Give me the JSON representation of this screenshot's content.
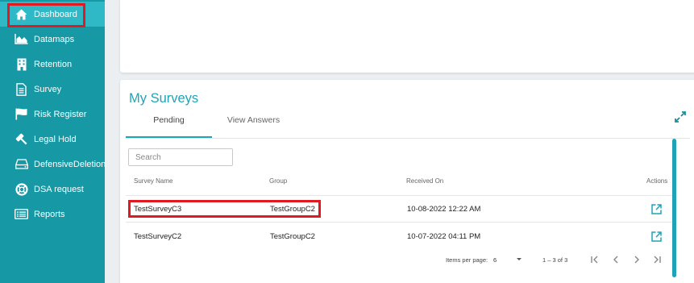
{
  "sidebar": {
    "items": [
      {
        "label": "Dashboard",
        "icon": "home-icon"
      },
      {
        "label": "Datamaps",
        "icon": "area-chart-icon"
      },
      {
        "label": "Retention",
        "icon": "building-icon"
      },
      {
        "label": "Survey",
        "icon": "document-icon"
      },
      {
        "label": "Risk Register",
        "icon": "flag-icon"
      },
      {
        "label": "Legal Hold",
        "icon": "gavel-icon"
      },
      {
        "label": "DefensiveDeletion",
        "icon": "drive-icon"
      },
      {
        "label": "DSA request",
        "icon": "lifebuoy-icon"
      },
      {
        "label": "Reports",
        "icon": "list-icon"
      }
    ],
    "active": "Dashboard"
  },
  "surveys": {
    "title": "My Surveys",
    "tabs": [
      "Pending",
      "View Answers"
    ],
    "active_tab": "Pending",
    "search_placeholder": "Search",
    "columns": [
      "Survey Name",
      "Group",
      "Received On",
      "Actions"
    ],
    "rows": [
      {
        "name": "TestSurveyC3",
        "group": "TestGroupC2",
        "received": "10-08-2022 12:22 AM"
      },
      {
        "name": "TestSurveyC2",
        "group": "TestGroupC2",
        "received": "10-07-2022 04:11 PM"
      }
    ],
    "pagination": {
      "items_per_page_label": "Items per page:",
      "items_per_page": "6",
      "range": "1 – 3 of 3"
    }
  },
  "colors": {
    "sidebar": "#1698a5",
    "sidebar_active": "#2fb9c7",
    "accent": "#1ea4b6",
    "highlight": "#e01a22"
  }
}
